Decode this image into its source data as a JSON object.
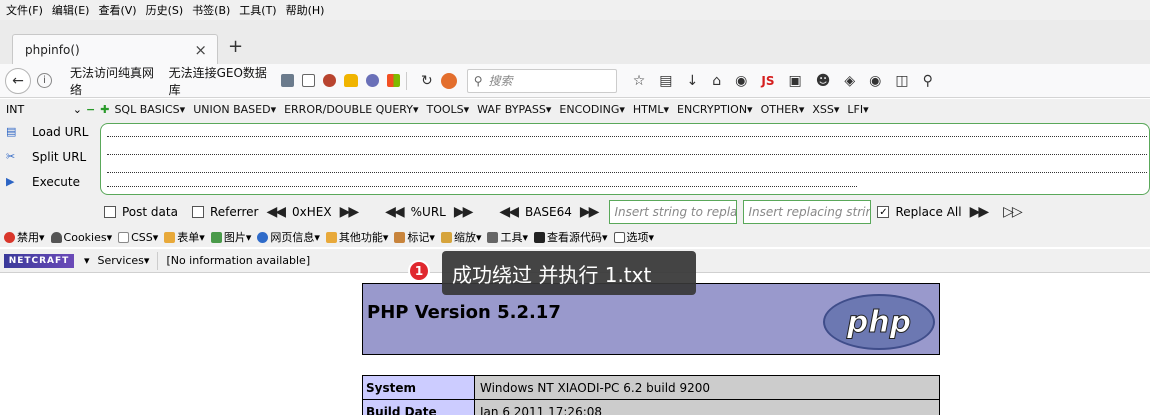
{
  "menubar": [
    "文件(F)",
    "编辑(E)",
    "查看(V)",
    "历史(S)",
    "书签(B)",
    "工具(T)",
    "帮助(H)"
  ],
  "tab": {
    "title": "phpinfo()",
    "close": "×",
    "new_tab": "+"
  },
  "navbar": {
    "url_text_1": "无法访问纯真网络",
    "url_text_2": "无法连接GEO数据库",
    "search_placeholder": "搜索",
    "badge_js": "JS"
  },
  "hackbar": {
    "select_value": "INT",
    "menu": [
      "SQL BASICS▾",
      "UNION BASED▾",
      "ERROR/DOUBLE QUERY▾",
      "TOOLS▾",
      "WAF BYPASS▾",
      "ENCODING▾",
      "HTML▾",
      "ENCRYPTION▾",
      "OTHER▾",
      "XSS▾",
      "LFI▾"
    ],
    "load_url": "Load URL",
    "split_url": "Split URL",
    "execute": "Execute",
    "post_data": "Post data",
    "referrer": "Referrer",
    "hex": "0xHEX",
    "url_enc": "%URL",
    "base64": "BASE64",
    "insert_replace": "Insert string to replace",
    "insert_replacing": "Insert replacing string",
    "replace_all": "Replace All"
  },
  "webdev": [
    "禁用▾",
    "Cookies▾",
    "CSS▾",
    "表单▾",
    "图片▾",
    "网页信息▾",
    "其他功能▾",
    "标记▾",
    "缩放▾",
    "工具▾",
    "查看源代码▾",
    "选项▾"
  ],
  "netcraft": {
    "logo": "NETCRAFT",
    "services": "Services▾",
    "info": "[No information available]"
  },
  "tooltip": {
    "badge": "1",
    "text": "成功绕过 并执行 1.txt"
  },
  "php": {
    "title": "PHP Version 5.2.17",
    "logo": "php",
    "rows": [
      {
        "key": "System",
        "value": "Windows NT XIAODI-PC 6.2 build 9200"
      },
      {
        "key": "Build Date",
        "value": "Jan 6 2011 17:26:08"
      }
    ]
  }
}
